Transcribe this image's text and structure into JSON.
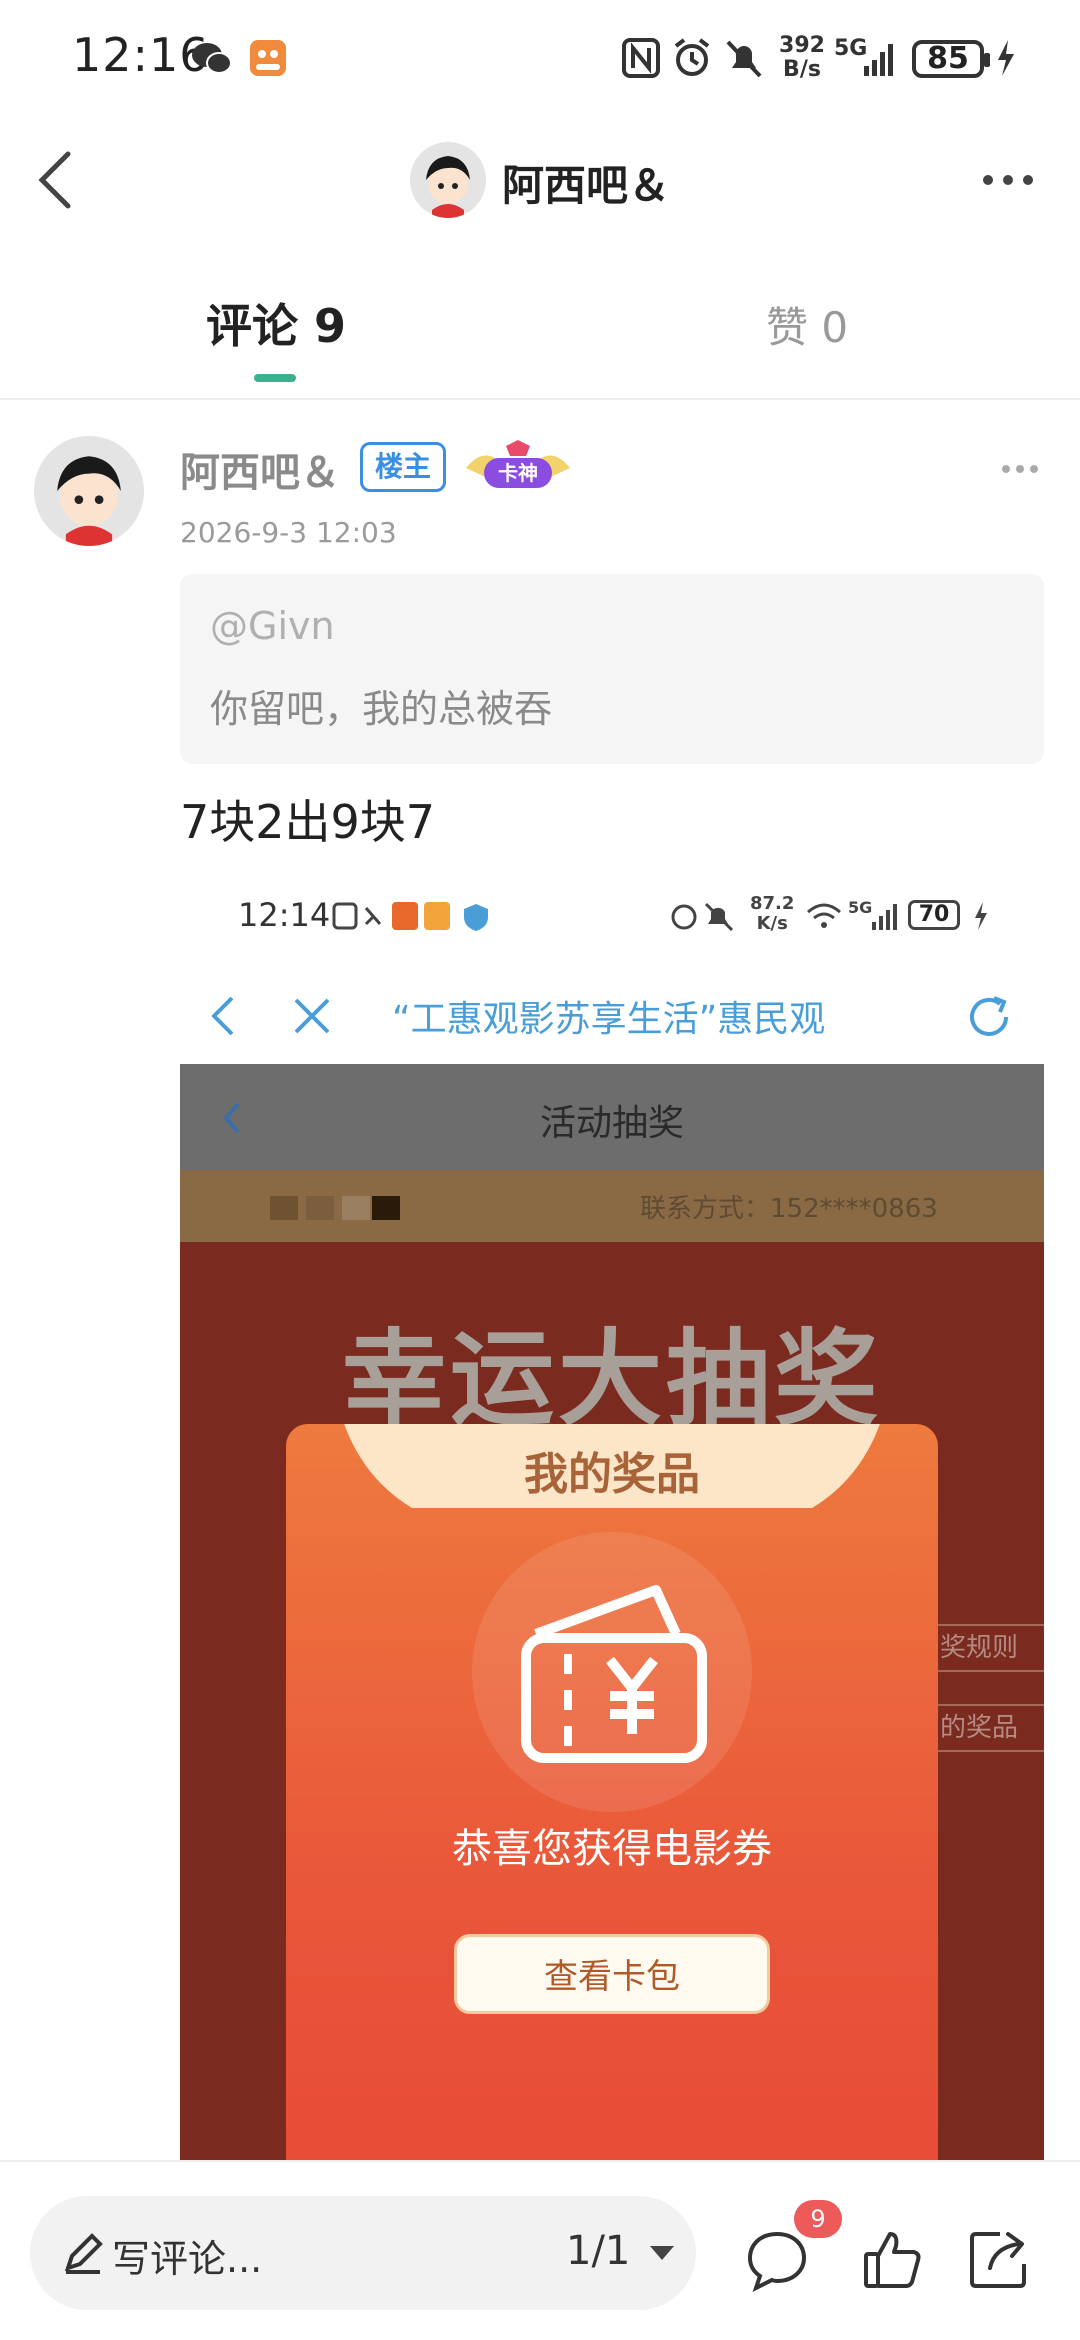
{
  "status_bar": {
    "time": "12:16",
    "net_speed": "392",
    "net_unit": "B/s",
    "network": "5G",
    "battery": "85"
  },
  "header": {
    "title": "阿西吧＆"
  },
  "tabs": {
    "comments": "评论 9",
    "likes": "赞 0"
  },
  "comment": {
    "author": "阿西吧＆",
    "op_badge": "楼主",
    "medal_text": "卡神",
    "time": "2026-9-3 12:03",
    "quote_user": "@Givn",
    "quote_text": "你留吧，我的总被吞",
    "text": "7块2出9块7"
  },
  "embedded_screenshot": {
    "status_time": "12:14",
    "net_speed": "87.2",
    "net_unit": "K/s",
    "network": "5G",
    "battery": "70",
    "nav_title": "“工惠观影苏享生活”惠民观",
    "page_title": "活动抽奖",
    "contact": "联系方式：152****0863",
    "big_title": "幸运大抽奖",
    "side_button_1": "奖规则",
    "side_button_2": "的奖品",
    "prize_title": "我的奖品",
    "prize_text": "恭喜您获得电影券",
    "prize_button": "查看卡包"
  },
  "bottom_bar": {
    "write_placeholder": "写评论...",
    "page_indicator": "1/1",
    "comment_count": "9"
  },
  "colors": {
    "accent_green": "#3fb08f",
    "op_badge_blue": "#3b8fe0",
    "badge_red": "#ee5a5a",
    "prize_orange": "#e9573a"
  }
}
